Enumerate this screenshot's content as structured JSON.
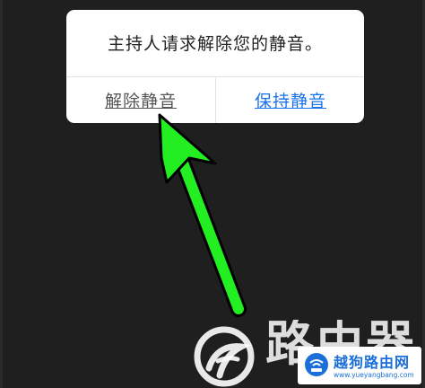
{
  "dialog": {
    "message": "主持人请求解除您的静音。",
    "unmute_label": "解除静音",
    "keep_muted_label": "保持静音"
  },
  "watermark": {
    "text": "路由器",
    "badge_title": "越狗路由网",
    "badge_url": "www.yueyangbang.com"
  },
  "colors": {
    "background": "#1f1f1f",
    "dialog_background": "#ffffff",
    "primary_link": "#1a73e8",
    "secondary_link": "#555555",
    "arrow": "#22ee22"
  },
  "icons": {
    "annotation": "green-arrow-icon",
    "watermark_logo": "swirl-logo-icon",
    "badge_icon": "router-icon"
  }
}
